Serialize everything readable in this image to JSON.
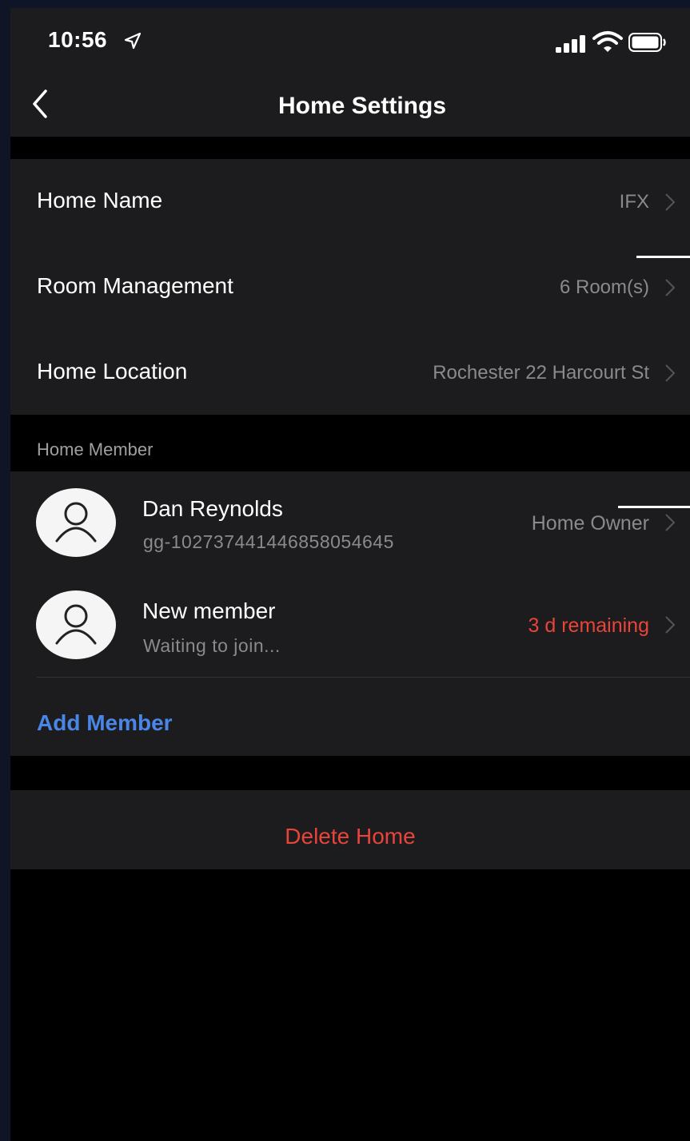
{
  "status_bar": {
    "time": "10:56",
    "icons": [
      "location-arrow-icon",
      "cellular-signal-icon",
      "wifi-icon",
      "battery-icon"
    ]
  },
  "nav": {
    "title": "Home Settings",
    "back_icon": "chevron-left-icon"
  },
  "settings": {
    "home_name": {
      "label": "Home Name",
      "value": "IFX"
    },
    "room_management": {
      "label": "Room Management",
      "value": "6 Room(s)"
    },
    "home_location": {
      "label": "Home Location",
      "value": "Rochester 22 Harcourt St"
    }
  },
  "members_section": {
    "header": "Home Member",
    "members": [
      {
        "name": "Dan Reynolds",
        "subtitle": "gg-10273744144685805464​5",
        "status": "Home Owner",
        "status_color": "#8a8a8e"
      },
      {
        "name": "New member",
        "subtitle": "Waiting to join...",
        "status": "3 d remaining",
        "status_color": "#e8443a"
      }
    ],
    "add_label": "Add Member"
  },
  "actions": {
    "delete_label": "Delete Home"
  },
  "colors": {
    "background": "#000000",
    "card": "#1c1c1e",
    "accent": "#4a86e8",
    "destructive": "#e8443a",
    "secondary_text": "#8a8a8e"
  }
}
